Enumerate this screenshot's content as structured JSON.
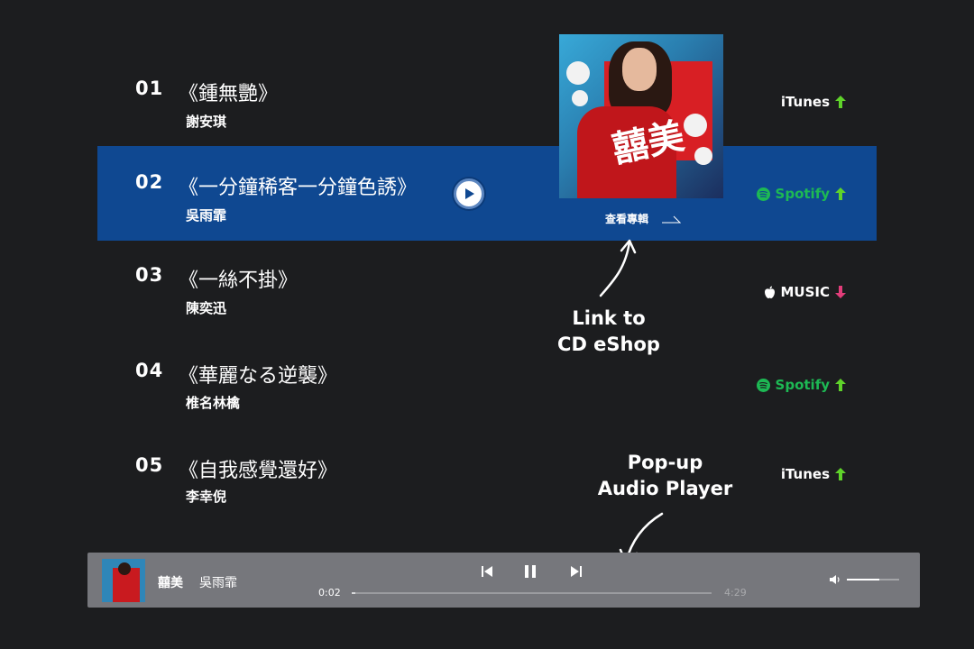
{
  "tracks": [
    {
      "num": "01",
      "title": "《鍾無艷》",
      "artist": "謝安琪",
      "service": "iTunes",
      "service_type": "itunes",
      "arrow_color": "#5fd32a"
    },
    {
      "num": "02",
      "title": "《一分鐘稀客一分鐘色誘》",
      "artist": "吳雨霏",
      "service": "Spotify",
      "service_type": "spotify",
      "arrow_color": "#5fd32a"
    },
    {
      "num": "03",
      "title": "《一絲不掛》",
      "artist": "陳奕迅",
      "service": "MUSIC",
      "service_type": "apple",
      "arrow_color": "#e23d7a"
    },
    {
      "num": "04",
      "title": "《華麗なる逆襲》",
      "artist": "椎名林檎",
      "service": "Spotify",
      "service_type": "spotify",
      "arrow_color": "#5fd32a"
    },
    {
      "num": "05",
      "title": "《自我感覺還好》",
      "artist": "李幸倪",
      "service": "iTunes",
      "service_type": "itunes",
      "arrow_color": "#5fd32a"
    }
  ],
  "album_cover": {
    "view_album_label": "查看專輯"
  },
  "annotations": {
    "eshop_line1": "Link to",
    "eshop_line2": "CD eShop",
    "player_line1": "Pop-up",
    "player_line2": "Audio Player"
  },
  "player": {
    "song": "囍美",
    "artist": "吳雨霏",
    "current_time": "0:02",
    "total_time": "4:29",
    "progress": 0.01,
    "volume": 0.62
  },
  "colors": {
    "active_row": "#0f4891",
    "spotify": "#1db954",
    "player_bg": "#76777c"
  }
}
